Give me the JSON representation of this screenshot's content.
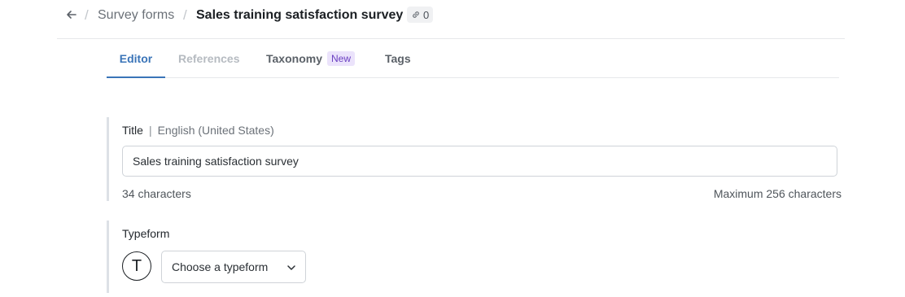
{
  "breadcrumb": {
    "parent": "Survey forms",
    "separator": "/",
    "title": "Sales training satisfaction survey",
    "links_count": "0"
  },
  "tabs": [
    {
      "label": "Editor",
      "active": true
    },
    {
      "label": "References",
      "disabled": true
    },
    {
      "label": "Taxonomy",
      "badge": "New"
    },
    {
      "label": "Tags"
    }
  ],
  "title_field": {
    "label": "Title",
    "locale": "English (United States)",
    "value": "Sales training satisfaction survey",
    "char_count": "34 characters",
    "max_chars": "Maximum 256 characters"
  },
  "typeform_field": {
    "label": "Typeform",
    "logo_letter": "T",
    "select_value": "Choose a typeform"
  },
  "colors": {
    "accent": "#3a74b8",
    "badge_bg": "#ebe3fb",
    "badge_text": "#6a3fc1"
  },
  "icons": {
    "back": "arrow-left-icon",
    "link": "link-icon",
    "chevron": "chevron-down-icon"
  }
}
